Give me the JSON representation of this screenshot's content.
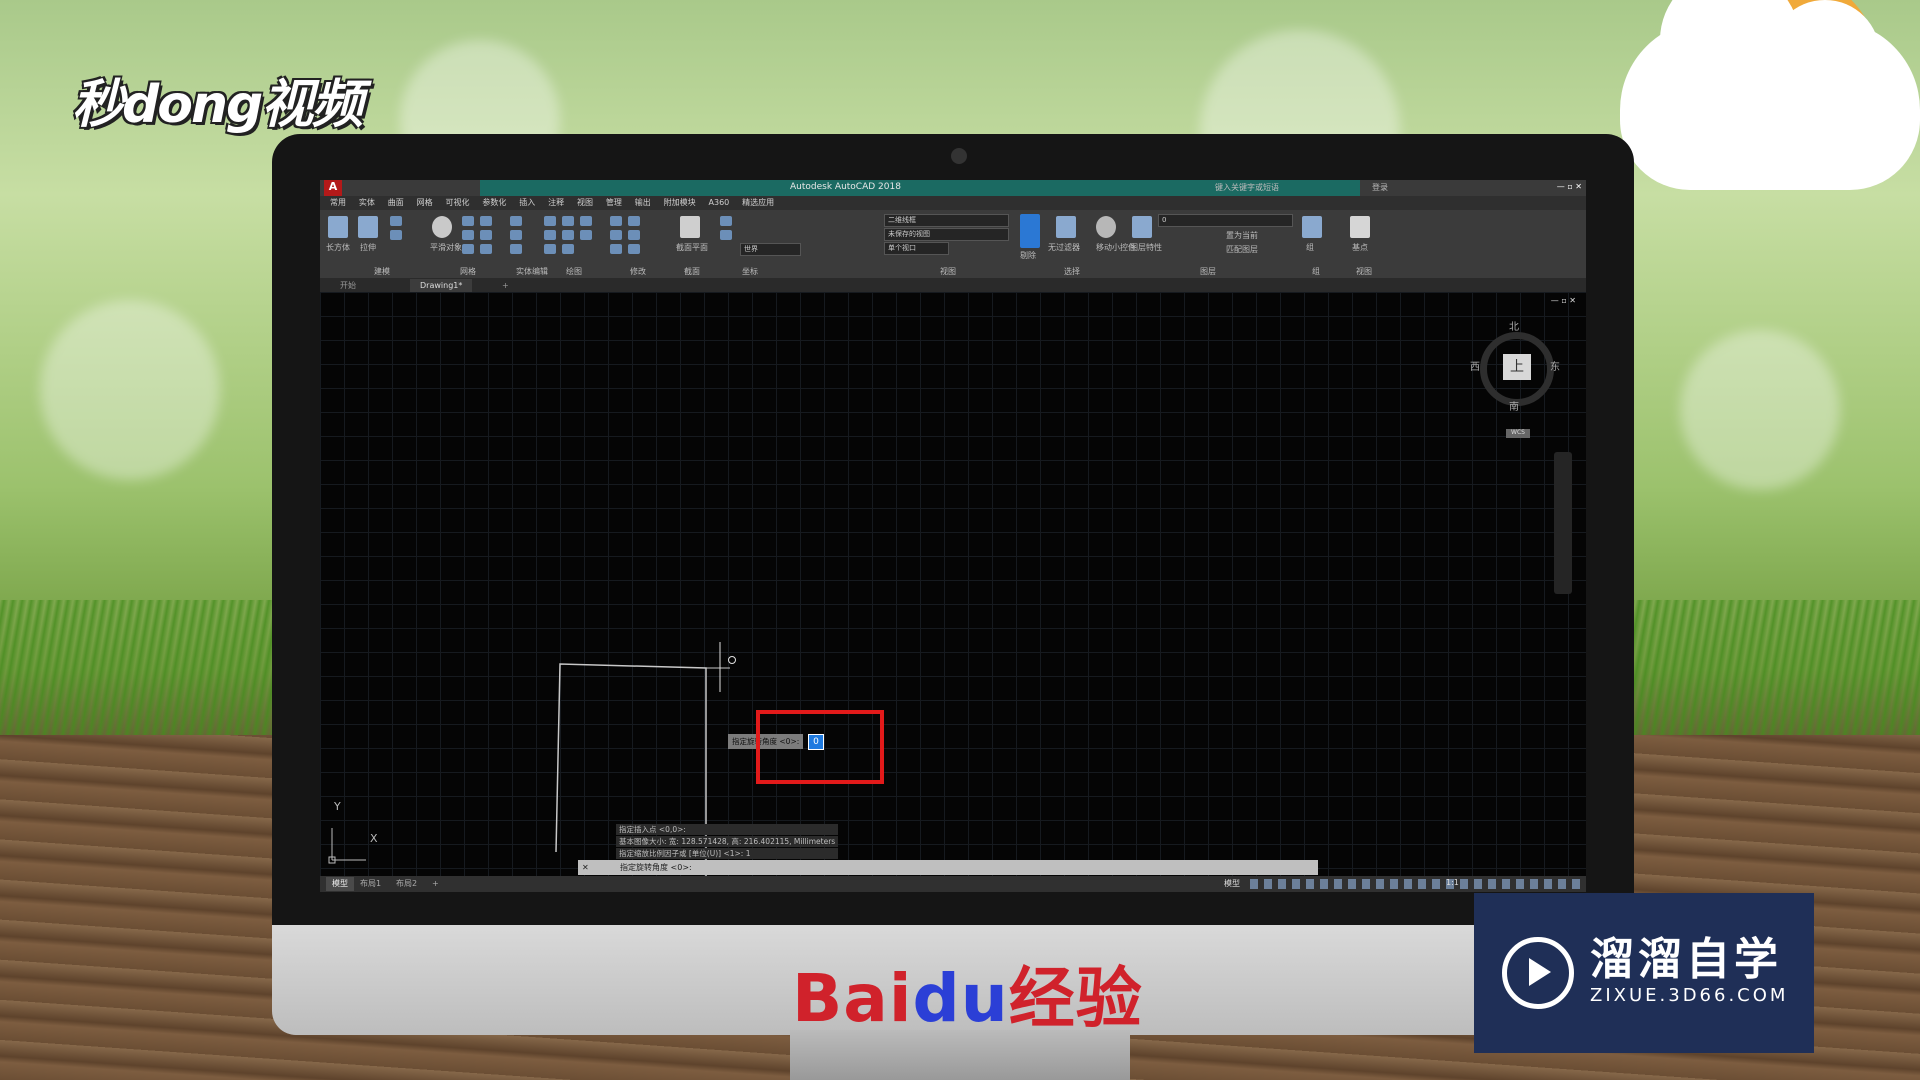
{
  "watermarks": {
    "top_left_logo": "秒dong视频",
    "baidu_brand": "Bai",
    "baidu_du": "du",
    "baidu_suffix": "经验",
    "zixue_title": "溜溜自学",
    "zixue_url": "ZIXUE.3D66.COM"
  },
  "autocad": {
    "app_icon": "A",
    "window_title": "Autodesk AutoCAD 2018",
    "search_placeholder": "键入关键字或短语",
    "signin_label": "登录",
    "window_buttons": "— ▫ ✕",
    "menu_tabs": [
      "常用",
      "实体",
      "曲面",
      "网格",
      "可视化",
      "参数化",
      "插入",
      "注释",
      "视图",
      "管理",
      "输出",
      "附加模块",
      "A360",
      "精选应用"
    ],
    "ribbon": {
      "box_label": "长方体",
      "extrude_label": "拉伸",
      "smooth_label": "平滑对象",
      "section_label": "截面平面",
      "filter_label": "无过滤器",
      "move_gizmo_label": "移动小控件",
      "layer_prop_label": "图层特性",
      "group_label": "组",
      "base_label": "基点",
      "visual_style": "二维线框",
      "view_state": "未保存的视图",
      "coord_world": "世界",
      "viewport": "单个视口",
      "layer_value": "0",
      "panels": [
        "建模",
        "网格",
        "实体编辑",
        "绘图",
        "修改",
        "截面",
        "坐标",
        "视图",
        "选择",
        "图层",
        "组",
        "视图"
      ],
      "culling_label": "剔除",
      "set_current_label": "置为当前",
      "match_layer_label": "匹配图层"
    },
    "tabs": [
      "开始",
      "Drawing1*"
    ],
    "viewport_controls": "— ▫ ✕",
    "viewcube": {
      "face": "上",
      "north": "北",
      "south": "南",
      "east": "东",
      "west": "西",
      "wcs": "WCS"
    },
    "ucs": {
      "x": "X",
      "y": "Y"
    },
    "command_history": [
      "指定插入点 <0,0>:",
      "基本图像大小: 宽: 128.571428, 高: 216.402115, Millimeters",
      "指定缩放比例因子或 [单位(U)] <1>: 1"
    ],
    "command_input": "指定旋转角度 <0>:",
    "command_close": "✕",
    "dynamic_input_prompt": "指定旋转角度 <0>:",
    "dynamic_input_value": "0",
    "layout_tabs": [
      "模型",
      "布局1",
      "布局2"
    ],
    "status_model": "模型",
    "status_scale": "1:1"
  }
}
